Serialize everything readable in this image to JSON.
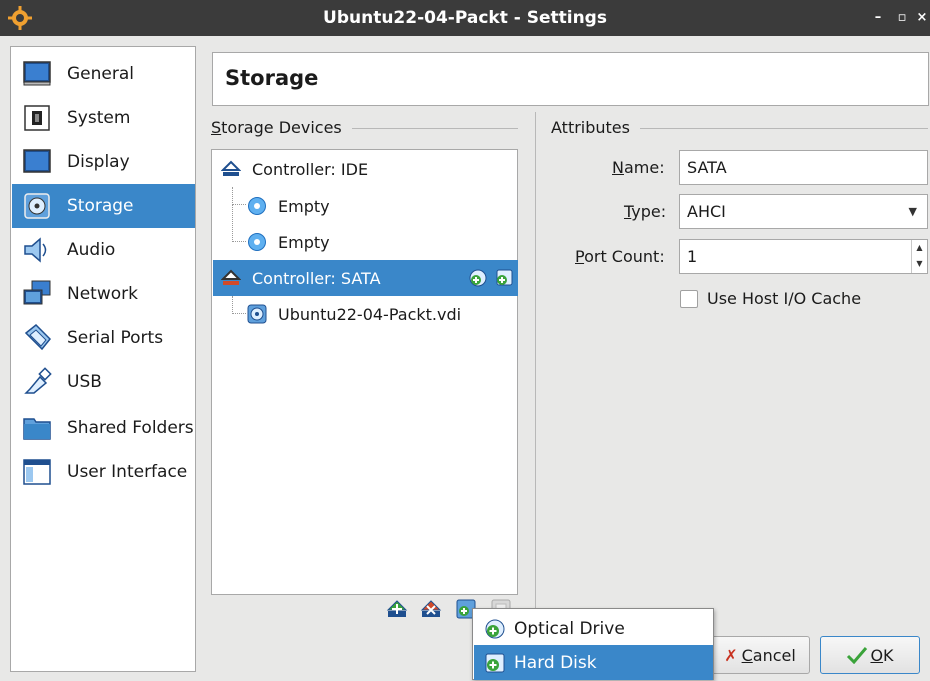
{
  "window": {
    "title": "Ubuntu22-04-Packt - Settings",
    "min_glyph": "–",
    "max_glyph": "▫",
    "close_glyph": "×"
  },
  "sidebar": {
    "items": [
      {
        "label": "General",
        "icon": "monitor-icon"
      },
      {
        "label": "System",
        "icon": "chip-icon"
      },
      {
        "label": "Display",
        "icon": "display-icon"
      },
      {
        "label": "Storage",
        "icon": "disk-icon",
        "selected": true
      },
      {
        "label": "Audio",
        "icon": "speaker-icon"
      },
      {
        "label": "Network",
        "icon": "network-icon"
      },
      {
        "label": "Serial Ports",
        "icon": "serial-port-icon"
      },
      {
        "label": "USB",
        "icon": "usb-icon"
      },
      {
        "label": "Shared Folders",
        "icon": "folder-icon"
      },
      {
        "label": "User Interface",
        "icon": "window-icon"
      }
    ]
  },
  "header": {
    "title": "Storage"
  },
  "storage_devices": {
    "title_first": "S",
    "title_rest": "torage Devices",
    "tree": [
      {
        "label": "Controller: IDE",
        "type": "controller"
      },
      {
        "label": "Empty",
        "type": "optical"
      },
      {
        "label": "Empty",
        "type": "optical"
      },
      {
        "label": "Controller: SATA",
        "type": "controller",
        "selected": true
      },
      {
        "label": "Ubuntu22-04-Packt.vdi",
        "type": "harddisk"
      }
    ]
  },
  "attributes": {
    "title": "Attributes",
    "name_label_first": "N",
    "name_label_rest": "ame:",
    "name_value": "SATA",
    "type_label_first": "T",
    "type_label_rest": "ype:",
    "type_value": "AHCI",
    "port_label_first": "P",
    "port_label_rest": "ort Count:",
    "port_value": "1",
    "host_cache_label": "Use Host I/O Cache",
    "host_cache_checked": false
  },
  "buttons": {
    "cancel_first": "C",
    "cancel_rest": "ancel",
    "ok_first": "O",
    "ok_rest": "K"
  },
  "popup_menu": {
    "items": [
      {
        "label": "Optical Drive"
      },
      {
        "label": "Hard Disk",
        "highlighted": true
      }
    ]
  },
  "colors": {
    "selection": "#3a87c9",
    "titlebar": "#3b3b3b",
    "add_green": "#3aa33a",
    "remove_red": "#d04a2a"
  }
}
